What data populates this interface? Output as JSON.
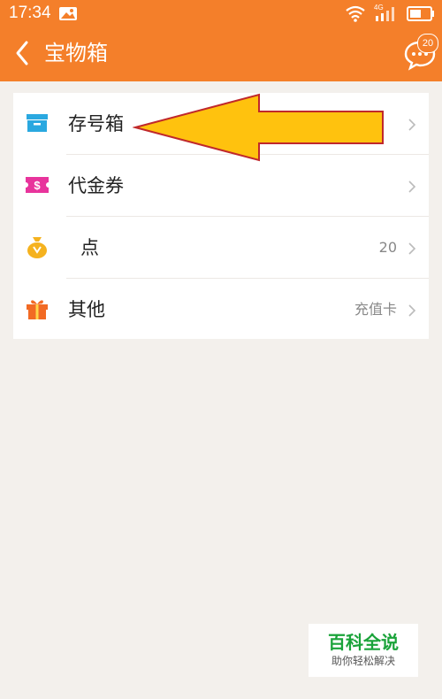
{
  "status_bar": {
    "time": "17:34",
    "network": "4G"
  },
  "header": {
    "title": "宝物箱",
    "message_badge": "20"
  },
  "list": [
    {
      "label": "存号箱",
      "value": "",
      "icon": "archive-box-icon"
    },
    {
      "label": "代金券",
      "value": "",
      "icon": "coupon-icon"
    },
    {
      "label": "点",
      "value": "20",
      "icon": "money-bag-icon"
    },
    {
      "label": "其他",
      "value": "充值卡",
      "icon": "gift-icon"
    }
  ],
  "annotation": {
    "type": "arrow",
    "color": "#ffc20e",
    "outline": "#c0282b",
    "points_to": "存号箱"
  },
  "watermark": {
    "main": "百科全说",
    "sub": "助你轻松解决"
  },
  "colors": {
    "header": "#f47f2a",
    "background": "#f3f0ec",
    "card": "#ffffff",
    "watermark_green": "#1aa33a"
  }
}
